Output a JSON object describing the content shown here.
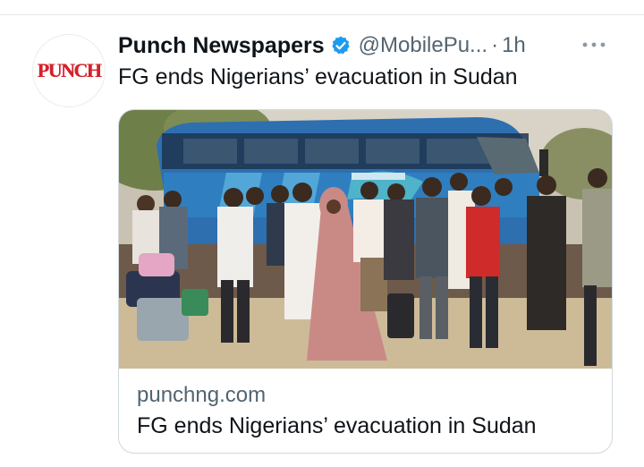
{
  "tweet": {
    "author": {
      "name": "Punch Newspapers",
      "handle": "@MobilePu...",
      "avatar_text": "PUNCH",
      "verified": true
    },
    "separator": "·",
    "timestamp": "1h",
    "text": "FG ends Nigerians’ evacuation in Sudan",
    "more_icon": "more-horizontal-icon"
  },
  "link_card": {
    "image_description_icon": "photo",
    "domain": "punchng.com",
    "title": "FG ends Nigerians’ evacuation in Sudan"
  },
  "colors": {
    "text_primary": "#0f1419",
    "text_secondary": "#536471",
    "verified_blue": "#1d9bf0",
    "border": "#cfd9de",
    "punch_red": "#d5212b"
  }
}
